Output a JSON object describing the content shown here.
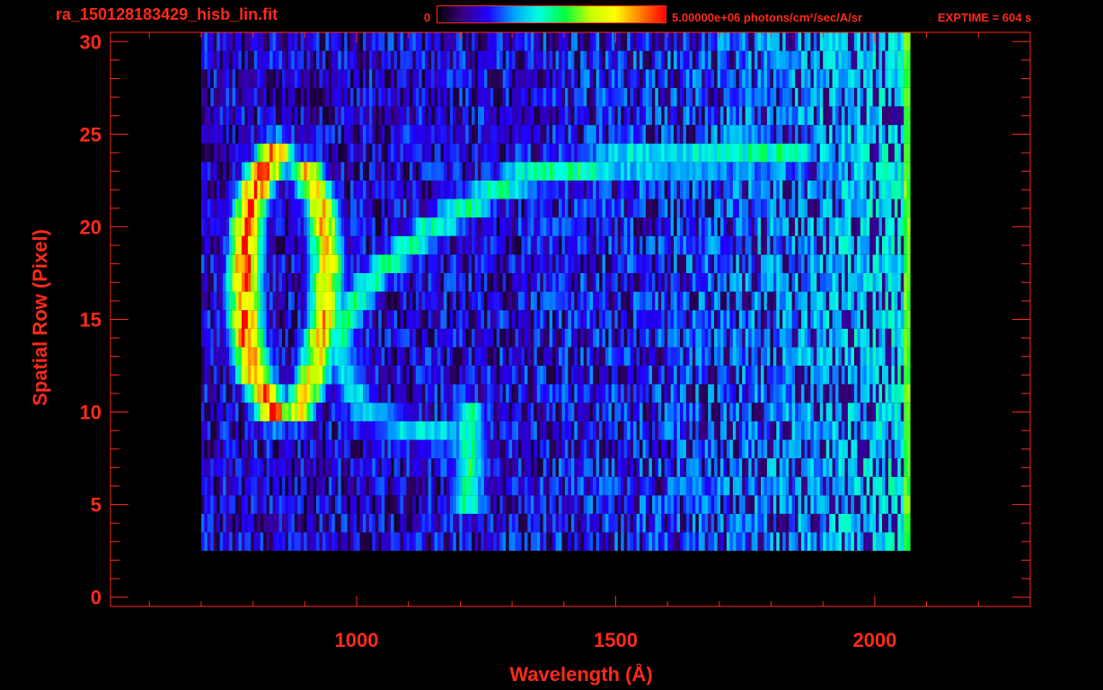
{
  "header": {
    "file_name": "ra_150128183429_hisb_lin.fit",
    "colorbar_min": "0",
    "colorbar_max": "5.00000e+06 photons/cm²/sec/A/sr",
    "exptime": "EXPTIME = 604 s"
  },
  "colors": {
    "axis": "#ff2a1a",
    "background": "#000000",
    "colormap": [
      "#000000",
      "#3a0080",
      "#2000ff",
      "#00a0ff",
      "#00ffe0",
      "#00ff40",
      "#c0ff00",
      "#ffff00",
      "#ff8000",
      "#ff0000"
    ]
  },
  "chart_data": {
    "type": "heatmap",
    "title": "ra_150128183429_hisb_lin.fit",
    "xlabel": "Wavelength (Å)",
    "ylabel": "Spatial Row (Pixel)",
    "xlim": [
      525,
      2300
    ],
    "ylim": [
      -0.5,
      30.5
    ],
    "x_ticks": [
      1000,
      1500,
      2000
    ],
    "y_ticks": [
      0,
      5,
      10,
      15,
      20,
      25,
      30
    ],
    "colorbar": {
      "min": 0,
      "max": 5000000,
      "units": "photons/cm²/sec/A/sr"
    },
    "data_extent": {
      "x": [
        700,
        2065
      ],
      "y": [
        3,
        30
      ]
    },
    "features": [
      {
        "name": "ring-outer-left",
        "points": [
          [
            840,
            24
          ],
          [
            800,
            22
          ],
          [
            785,
            20
          ],
          [
            780,
            17
          ],
          [
            785,
            14
          ],
          [
            800,
            12
          ],
          [
            840,
            10
          ]
        ],
        "intensity": 1.0
      },
      {
        "name": "ring-inner",
        "points": [
          [
            900,
            23
          ],
          [
            930,
            21
          ],
          [
            940,
            18
          ],
          [
            935,
            15
          ],
          [
            915,
            12
          ],
          [
            880,
            10
          ]
        ],
        "intensity": 0.85
      },
      {
        "name": "diagonal-arc",
        "points": [
          [
            960,
            14
          ],
          [
            1020,
            17
          ],
          [
            1100,
            19
          ],
          [
            1200,
            21
          ],
          [
            1300,
            22.5
          ],
          [
            1500,
            23.5
          ],
          [
            1850,
            23.8
          ]
        ],
        "intensity": 0.55
      },
      {
        "name": "lower-arc",
        "points": [
          [
            960,
            13
          ],
          [
            1010,
            10
          ],
          [
            1100,
            9
          ],
          [
            1200,
            8.5
          ]
        ],
        "intensity": 0.45
      },
      {
        "name": "lyman-alpha",
        "points": [
          [
            1215,
            5
          ],
          [
            1215,
            10
          ]
        ],
        "intensity": 0.55
      }
    ]
  }
}
